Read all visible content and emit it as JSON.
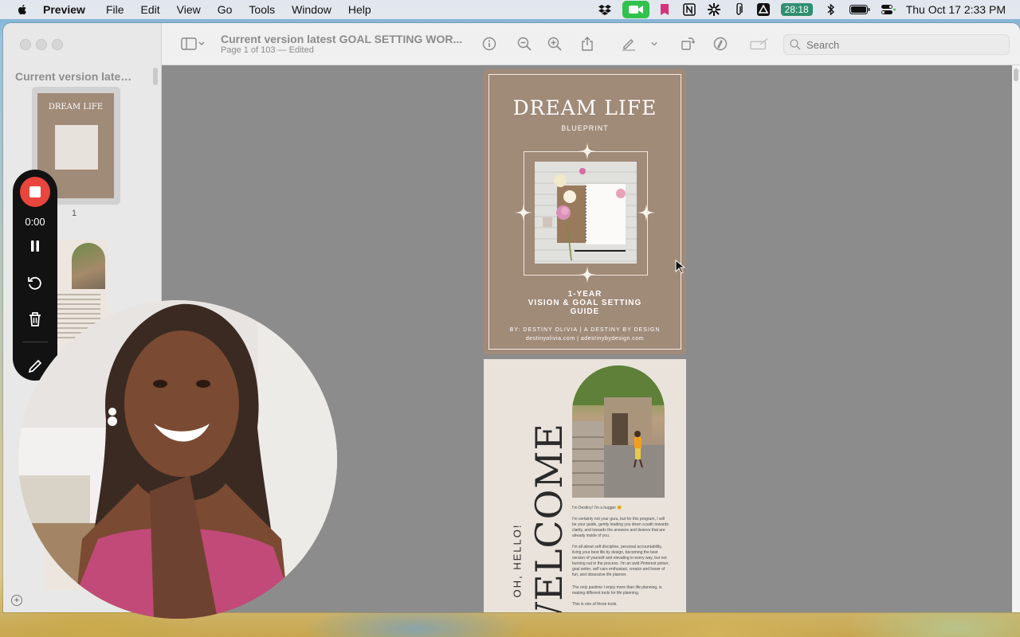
{
  "menubar": {
    "app_name": "Preview",
    "items": [
      "File",
      "Edit",
      "View",
      "Go",
      "Tools",
      "Window",
      "Help"
    ],
    "timer_badge": "28:18",
    "clock": "Thu Oct 17  2:33 PM"
  },
  "window": {
    "doc_title": "Current version latest GOAL SETTING WOR...",
    "doc_subtitle": "Page 1 of 103 — Edited",
    "search_placeholder": "Search"
  },
  "sidebar": {
    "title": "Current version lates...",
    "thumbnails": [
      {
        "page_label": "1",
        "title": "DREAM LIFE"
      }
    ]
  },
  "page1": {
    "title": "DREAM LIFE",
    "subtitle": "BLUEPRINT",
    "guide_lines": [
      "1-YEAR",
      "VISION & GOAL SETTING",
      "GUIDE"
    ],
    "byline": "BY: DESTINY OLIVIA | A DESTINY BY DESIGN",
    "urls": "destinyolivia.com | adestinybydesign.com"
  },
  "page2": {
    "greeting": "OH, HELLO!",
    "welcome": "WELCOME",
    "paragraphs": [
      "I'm Destiny! I'm a hugger 🤗",
      "I'm certainly not your guru, but for this program, I will be your guide, gently leading you down a path towards clarity, and towards the answers and desires that are already inside of you.",
      "I'm all about soft discipline, personal accountability, living your best life by design, becoming the best version of yourself and elevating in every way, but not burning out in the process. I'm an avid Pinterest pinner, goal setter, self care enthusiast, creator and haver of fun, and obsessive life planner.",
      "The only pastime I enjoy more than life planning, is making different tools for life planning.",
      "This is one of those tools."
    ]
  },
  "recorder": {
    "elapsed": "0:00"
  },
  "colors": {
    "page1_bg": "#a08a78",
    "page2_bg": "#e9e3dc",
    "record_red": "#e8453c",
    "recorder_bg": "#121212"
  }
}
